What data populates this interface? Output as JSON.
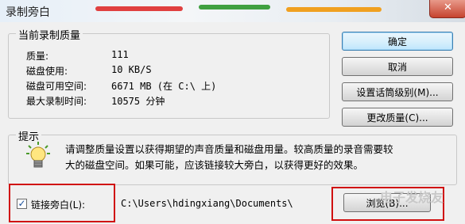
{
  "window": {
    "title": "录制旁白",
    "close_glyph": "✕"
  },
  "quality": {
    "group_title": "当前录制质量",
    "rows": [
      {
        "label": "质量:",
        "value": "111"
      },
      {
        "label": "磁盘使用:",
        "value": "10 KB/S"
      },
      {
        "label": "磁盘可用空间:",
        "value": "6671 MB (在 C:\\ 上)"
      },
      {
        "label": "最大录制时间:",
        "value": "10575 分钟"
      }
    ]
  },
  "buttons": {
    "ok": "确定",
    "cancel": "取消",
    "mic_level": "设置话筒级别(M)...",
    "change_quality": "更改质量(C)...",
    "browse": "浏览(B)..."
  },
  "hint": {
    "group_title": "提示",
    "text_line1": "请调整质量设置以获得期望的声音质量和磁盘用量。较高质量的录音需要较",
    "text_line2": "大的磁盘空间。如果可能，应该链接较大旁白，以获得更好的效果。",
    "icon": "lightbulb-icon"
  },
  "link": {
    "checkbox_label": "链接旁白(L):",
    "checked": true,
    "path": "C:\\Users\\hdingxiang\\Documents\\"
  },
  "watermark": "电子发烧友",
  "colors": {
    "highlight": "#d01010",
    "default_button_border": "#3c7fb1"
  }
}
